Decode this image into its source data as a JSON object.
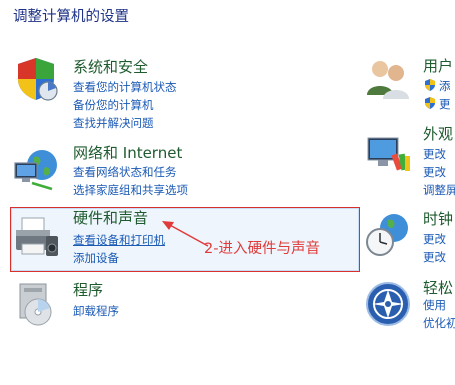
{
  "page_title": "调整计算机的设置",
  "categories": {
    "system": {
      "title": "系统和安全",
      "links": [
        "查看您的计算机状态",
        "备份您的计算机",
        "查找并解决问题"
      ]
    },
    "network": {
      "title": "网络和 Internet",
      "links": [
        "查看网络状态和任务",
        "选择家庭组和共享选项"
      ]
    },
    "hardware": {
      "title": "硬件和声音",
      "links": [
        "查看设备和打印机",
        "添加设备"
      ]
    },
    "programs": {
      "title": "程序",
      "links": [
        "卸载程序"
      ]
    },
    "user": {
      "title": "用户",
      "links": [
        "添",
        "更"
      ]
    },
    "appearance": {
      "title": "外观",
      "links": [
        "更改",
        "更改",
        "调整屏"
      ]
    },
    "clock": {
      "title": "时钟",
      "links": [
        "更改",
        "更改"
      ]
    },
    "ease": {
      "title": "轻松",
      "links": [
        "使用",
        "优化初"
      ]
    }
  },
  "annotation": {
    "text": "2-进入硬件与声音",
    "color": "#e03a3a"
  },
  "colors": {
    "title_green": "#1e5b2e",
    "link_blue": "#1b5ab5",
    "heading_blue": "#1e3287",
    "highlight_border": "#d8302c"
  }
}
